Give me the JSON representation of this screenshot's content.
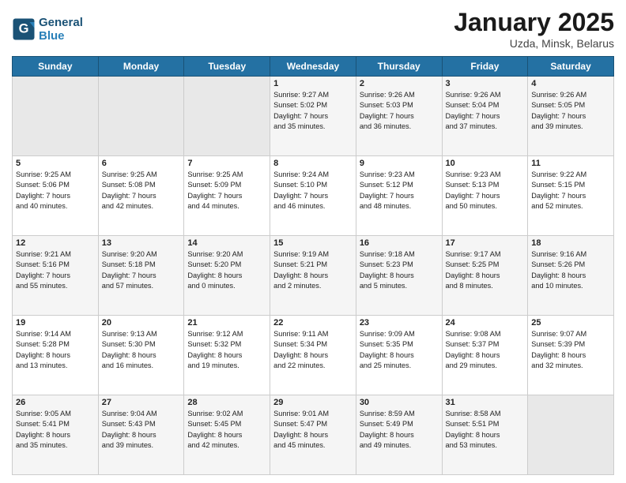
{
  "header": {
    "logo_line1": "General",
    "logo_line2": "Blue",
    "month": "January 2025",
    "location": "Uzda, Minsk, Belarus"
  },
  "days_of_week": [
    "Sunday",
    "Monday",
    "Tuesday",
    "Wednesday",
    "Thursday",
    "Friday",
    "Saturday"
  ],
  "weeks": [
    [
      {
        "day": "",
        "info": ""
      },
      {
        "day": "",
        "info": ""
      },
      {
        "day": "",
        "info": ""
      },
      {
        "day": "1",
        "info": "Sunrise: 9:27 AM\nSunset: 5:02 PM\nDaylight: 7 hours\nand 35 minutes."
      },
      {
        "day": "2",
        "info": "Sunrise: 9:26 AM\nSunset: 5:03 PM\nDaylight: 7 hours\nand 36 minutes."
      },
      {
        "day": "3",
        "info": "Sunrise: 9:26 AM\nSunset: 5:04 PM\nDaylight: 7 hours\nand 37 minutes."
      },
      {
        "day": "4",
        "info": "Sunrise: 9:26 AM\nSunset: 5:05 PM\nDaylight: 7 hours\nand 39 minutes."
      }
    ],
    [
      {
        "day": "5",
        "info": "Sunrise: 9:25 AM\nSunset: 5:06 PM\nDaylight: 7 hours\nand 40 minutes."
      },
      {
        "day": "6",
        "info": "Sunrise: 9:25 AM\nSunset: 5:08 PM\nDaylight: 7 hours\nand 42 minutes."
      },
      {
        "day": "7",
        "info": "Sunrise: 9:25 AM\nSunset: 5:09 PM\nDaylight: 7 hours\nand 44 minutes."
      },
      {
        "day": "8",
        "info": "Sunrise: 9:24 AM\nSunset: 5:10 PM\nDaylight: 7 hours\nand 46 minutes."
      },
      {
        "day": "9",
        "info": "Sunrise: 9:23 AM\nSunset: 5:12 PM\nDaylight: 7 hours\nand 48 minutes."
      },
      {
        "day": "10",
        "info": "Sunrise: 9:23 AM\nSunset: 5:13 PM\nDaylight: 7 hours\nand 50 minutes."
      },
      {
        "day": "11",
        "info": "Sunrise: 9:22 AM\nSunset: 5:15 PM\nDaylight: 7 hours\nand 52 minutes."
      }
    ],
    [
      {
        "day": "12",
        "info": "Sunrise: 9:21 AM\nSunset: 5:16 PM\nDaylight: 7 hours\nand 55 minutes."
      },
      {
        "day": "13",
        "info": "Sunrise: 9:20 AM\nSunset: 5:18 PM\nDaylight: 7 hours\nand 57 minutes."
      },
      {
        "day": "14",
        "info": "Sunrise: 9:20 AM\nSunset: 5:20 PM\nDaylight: 8 hours\nand 0 minutes."
      },
      {
        "day": "15",
        "info": "Sunrise: 9:19 AM\nSunset: 5:21 PM\nDaylight: 8 hours\nand 2 minutes."
      },
      {
        "day": "16",
        "info": "Sunrise: 9:18 AM\nSunset: 5:23 PM\nDaylight: 8 hours\nand 5 minutes."
      },
      {
        "day": "17",
        "info": "Sunrise: 9:17 AM\nSunset: 5:25 PM\nDaylight: 8 hours\nand 8 minutes."
      },
      {
        "day": "18",
        "info": "Sunrise: 9:16 AM\nSunset: 5:26 PM\nDaylight: 8 hours\nand 10 minutes."
      }
    ],
    [
      {
        "day": "19",
        "info": "Sunrise: 9:14 AM\nSunset: 5:28 PM\nDaylight: 8 hours\nand 13 minutes."
      },
      {
        "day": "20",
        "info": "Sunrise: 9:13 AM\nSunset: 5:30 PM\nDaylight: 8 hours\nand 16 minutes."
      },
      {
        "day": "21",
        "info": "Sunrise: 9:12 AM\nSunset: 5:32 PM\nDaylight: 8 hours\nand 19 minutes."
      },
      {
        "day": "22",
        "info": "Sunrise: 9:11 AM\nSunset: 5:34 PM\nDaylight: 8 hours\nand 22 minutes."
      },
      {
        "day": "23",
        "info": "Sunrise: 9:09 AM\nSunset: 5:35 PM\nDaylight: 8 hours\nand 25 minutes."
      },
      {
        "day": "24",
        "info": "Sunrise: 9:08 AM\nSunset: 5:37 PM\nDaylight: 8 hours\nand 29 minutes."
      },
      {
        "day": "25",
        "info": "Sunrise: 9:07 AM\nSunset: 5:39 PM\nDaylight: 8 hours\nand 32 minutes."
      }
    ],
    [
      {
        "day": "26",
        "info": "Sunrise: 9:05 AM\nSunset: 5:41 PM\nDaylight: 8 hours\nand 35 minutes."
      },
      {
        "day": "27",
        "info": "Sunrise: 9:04 AM\nSunset: 5:43 PM\nDaylight: 8 hours\nand 39 minutes."
      },
      {
        "day": "28",
        "info": "Sunrise: 9:02 AM\nSunset: 5:45 PM\nDaylight: 8 hours\nand 42 minutes."
      },
      {
        "day": "29",
        "info": "Sunrise: 9:01 AM\nSunset: 5:47 PM\nDaylight: 8 hours\nand 45 minutes."
      },
      {
        "day": "30",
        "info": "Sunrise: 8:59 AM\nSunset: 5:49 PM\nDaylight: 8 hours\nand 49 minutes."
      },
      {
        "day": "31",
        "info": "Sunrise: 8:58 AM\nSunset: 5:51 PM\nDaylight: 8 hours\nand 53 minutes."
      },
      {
        "day": "",
        "info": ""
      }
    ]
  ]
}
